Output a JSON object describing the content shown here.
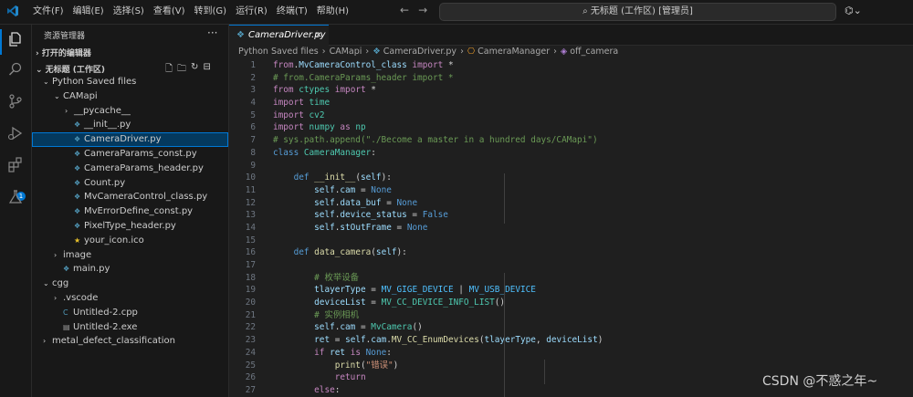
{
  "menu": [
    "文件(F)",
    "编辑(E)",
    "选择(S)",
    "查看(V)",
    "转到(G)",
    "运行(R)",
    "终端(T)",
    "帮助(H)"
  ],
  "nav": {
    "back": "←",
    "forward": "→"
  },
  "command_center": {
    "text": "⌕ 无标题 (工作区) [管理员]"
  },
  "copilot": {
    "label": "⌬⌄"
  },
  "activity_bar": {
    "extensions_badge": "1"
  },
  "sidebar": {
    "title": "资源管理器",
    "more": "···",
    "open_editors": "› 打开的编辑器",
    "workspace": "⌄ 无标题 (工作区)",
    "tree": [
      {
        "label": "Python Saved files",
        "depth": 0,
        "twisty": "⌄",
        "kind": "folder"
      },
      {
        "label": "CAMapi",
        "depth": 1,
        "twisty": "⌄",
        "kind": "folder"
      },
      {
        "label": "__pycache__",
        "depth": 2,
        "twisty": "›",
        "kind": "folder"
      },
      {
        "label": "__init__.py",
        "depth": 2,
        "twisty": "",
        "kind": "py"
      },
      {
        "label": "CameraDriver.py",
        "depth": 2,
        "twisty": "",
        "kind": "py",
        "selected": true
      },
      {
        "label": "CameraParams_const.py",
        "depth": 2,
        "twisty": "",
        "kind": "py"
      },
      {
        "label": "CameraParams_header.py",
        "depth": 2,
        "twisty": "",
        "kind": "py"
      },
      {
        "label": "Count.py",
        "depth": 2,
        "twisty": "",
        "kind": "py"
      },
      {
        "label": "MvCameraControl_class.py",
        "depth": 2,
        "twisty": "",
        "kind": "py"
      },
      {
        "label": "MvErrorDefine_const.py",
        "depth": 2,
        "twisty": "",
        "kind": "py"
      },
      {
        "label": "PixelType_header.py",
        "depth": 2,
        "twisty": "",
        "kind": "py"
      },
      {
        "label": "your_icon.ico",
        "depth": 2,
        "twisty": "",
        "kind": "ico"
      },
      {
        "label": "image",
        "depth": 1,
        "twisty": "›",
        "kind": "folder"
      },
      {
        "label": "main.py",
        "depth": 1,
        "twisty": "",
        "kind": "py"
      },
      {
        "label": "cgg",
        "depth": 0,
        "twisty": "⌄",
        "kind": "folder"
      },
      {
        "label": ".vscode",
        "depth": 1,
        "twisty": "›",
        "kind": "folder"
      },
      {
        "label": "Untitled-2.cpp",
        "depth": 1,
        "twisty": "",
        "kind": "cpp"
      },
      {
        "label": "Untitled-2.exe",
        "depth": 1,
        "twisty": "",
        "kind": "exe"
      },
      {
        "label": "metal_defect_classification",
        "depth": 0,
        "twisty": "›",
        "kind": "folder"
      }
    ]
  },
  "tab": {
    "label": "CameraDriver.py",
    "close": "×"
  },
  "breadcrumbs": [
    "Python Saved files",
    "CAMapi",
    "CameraDriver.py",
    "CameraManager",
    "off_camera"
  ],
  "code_lines": [
    "from.MvCameraControl_class import *",
    "# from.CameraParams_header import *",
    "from ctypes import *",
    "import time",
    "import cv2",
    "import numpy as np",
    "# sys.path.append(\"./Become a master in a hundred days/CAMapi\")",
    "class CameraManager:",
    "",
    "    def __init__(self):",
    "        self.cam = None",
    "        self.data_buf = None",
    "        self.device_status = False",
    "        self.stOutFrame = None",
    "",
    "    def data_camera(self):",
    "",
    "        # 枚举设备",
    "        tlayerType = MV_GIGE_DEVICE | MV_USB_DEVICE",
    "        deviceList = MV_CC_DEVICE_INFO_LIST()",
    "        # 实例相机",
    "        self.cam = MvCamera()",
    "        ret = self.cam.MV_CC_EnumDevices(tlayerType, deviceList)",
    "        if ret is None:",
    "            print(\"错误\")",
    "            return",
    "        else:"
  ],
  "watermark": "CSDN @不惑之年~"
}
